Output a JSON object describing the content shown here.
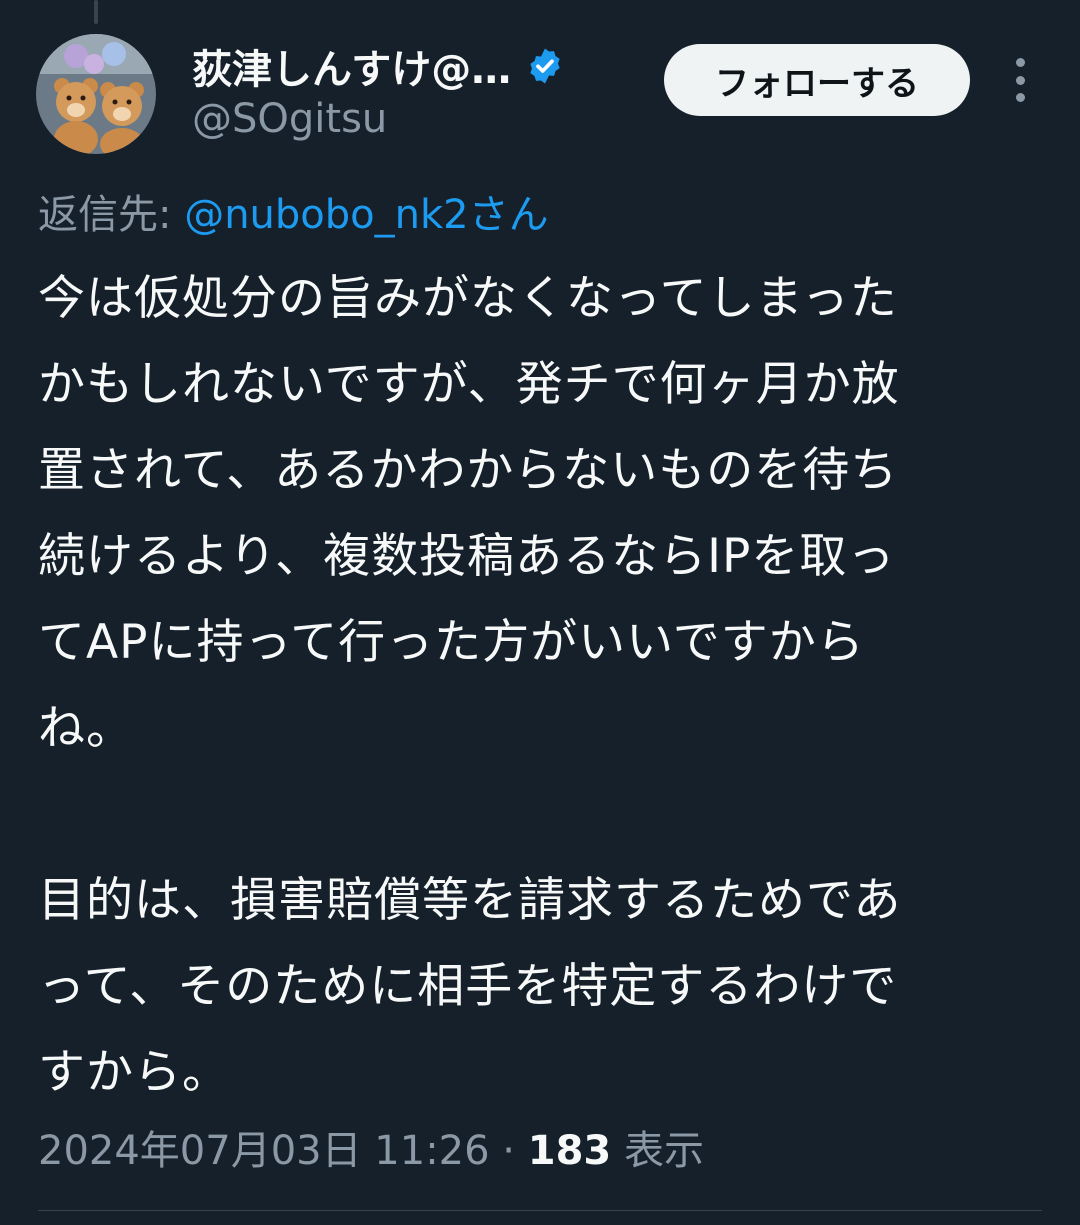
{
  "author": {
    "display_name": "荻津しんすけ@…",
    "handle": "@SOgitsu",
    "avatar": "teddy-bears-photo",
    "verified_icon": "verified-badge-icon"
  },
  "follow_button": {
    "label": "フォローする"
  },
  "more_icon": "more-vertical-icon",
  "reply": {
    "prefix": "返信先: ",
    "mention": "@nubobo_nk2さん"
  },
  "tweet": {
    "lines": [
      "今は仮処分の旨みがなくなってしまった",
      "かもしれないですが、発チで何ヶ月か放",
      "置されて、あるかわからないものを待ち",
      "続けるより、複数投稿あるならIPを取っ",
      "てAPに持って行った方がいいですから",
      "ね。",
      "",
      "目的は、損害賠償等を請求するためであ",
      "って、そのために相手を特定するわけで",
      "すから。"
    ]
  },
  "meta": {
    "datetime": "2024年07月03日 11:26",
    "separator": " · ",
    "views_count": "183",
    "views_label": " 表示"
  },
  "colors": {
    "background": "#15202b",
    "text": "#f7f9f9",
    "secondary": "#8b98a5",
    "accent": "#1d9bf0"
  }
}
